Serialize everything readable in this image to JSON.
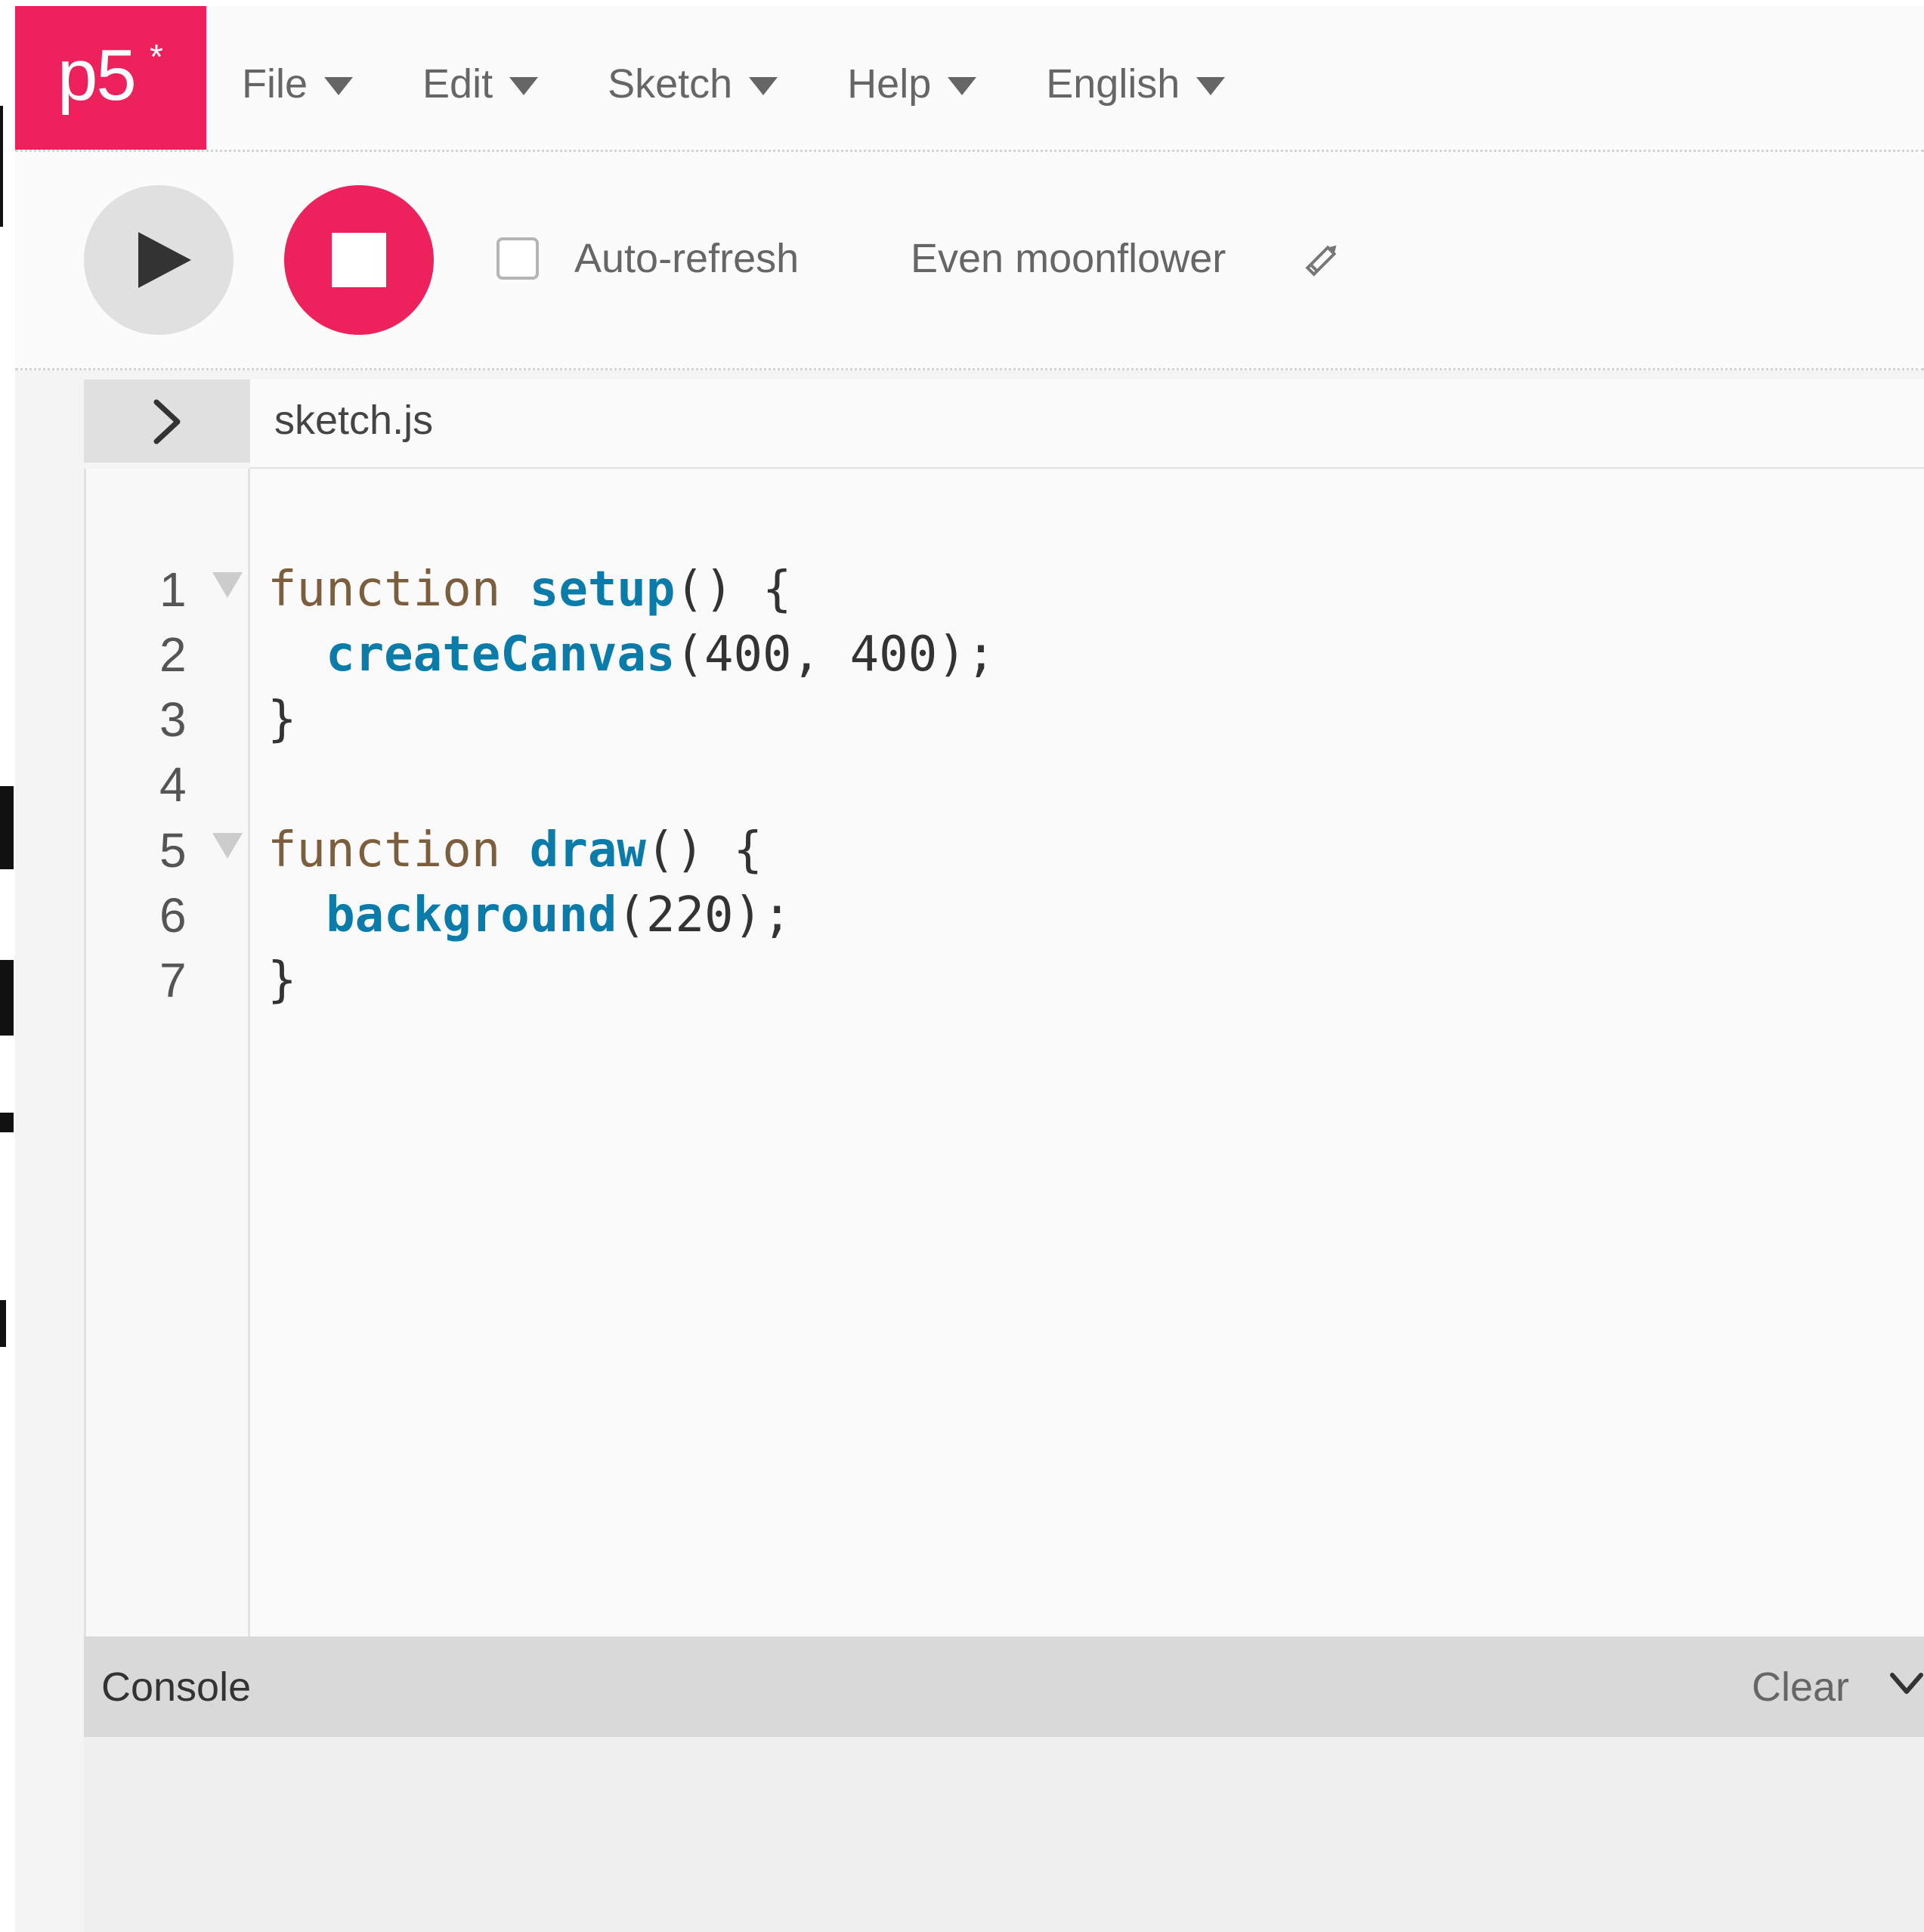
{
  "nav": {
    "logo_text": "p5",
    "logo_star": "*",
    "menu": [
      {
        "label": "File"
      },
      {
        "label": "Edit"
      },
      {
        "label": "Sketch"
      },
      {
        "label": "Help"
      },
      {
        "label": "English"
      }
    ]
  },
  "toolbar": {
    "play_icon": "play-icon",
    "stop_icon": "stop-icon",
    "auto_refresh_label": "Auto-refresh",
    "auto_refresh_checked": false,
    "sketch_name": "Even moonflower",
    "edit_name_icon": "pencil-icon"
  },
  "editor": {
    "files_toggle_icon": "chevron-right-icon",
    "file_name": "sketch.js",
    "lines": [
      {
        "number": "1",
        "foldable": true,
        "text": "function setup() {"
      },
      {
        "number": "2",
        "foldable": false,
        "text": "  createCanvas(400, 400);"
      },
      {
        "number": "3",
        "foldable": false,
        "text": "}"
      },
      {
        "number": "4",
        "foldable": false,
        "text": ""
      },
      {
        "number": "5",
        "foldable": true,
        "text": "function draw() {"
      },
      {
        "number": "6",
        "foldable": false,
        "text": "  background(220);"
      },
      {
        "number": "7",
        "foldable": false,
        "text": "}"
      }
    ]
  },
  "console": {
    "title": "Console",
    "clear_label": "Clear",
    "collapse_icon": "chevron-down-icon"
  },
  "colors": {
    "brand": "#ed225d",
    "keyword": "#7a5e3e",
    "function_name": "#0b7ca9"
  }
}
